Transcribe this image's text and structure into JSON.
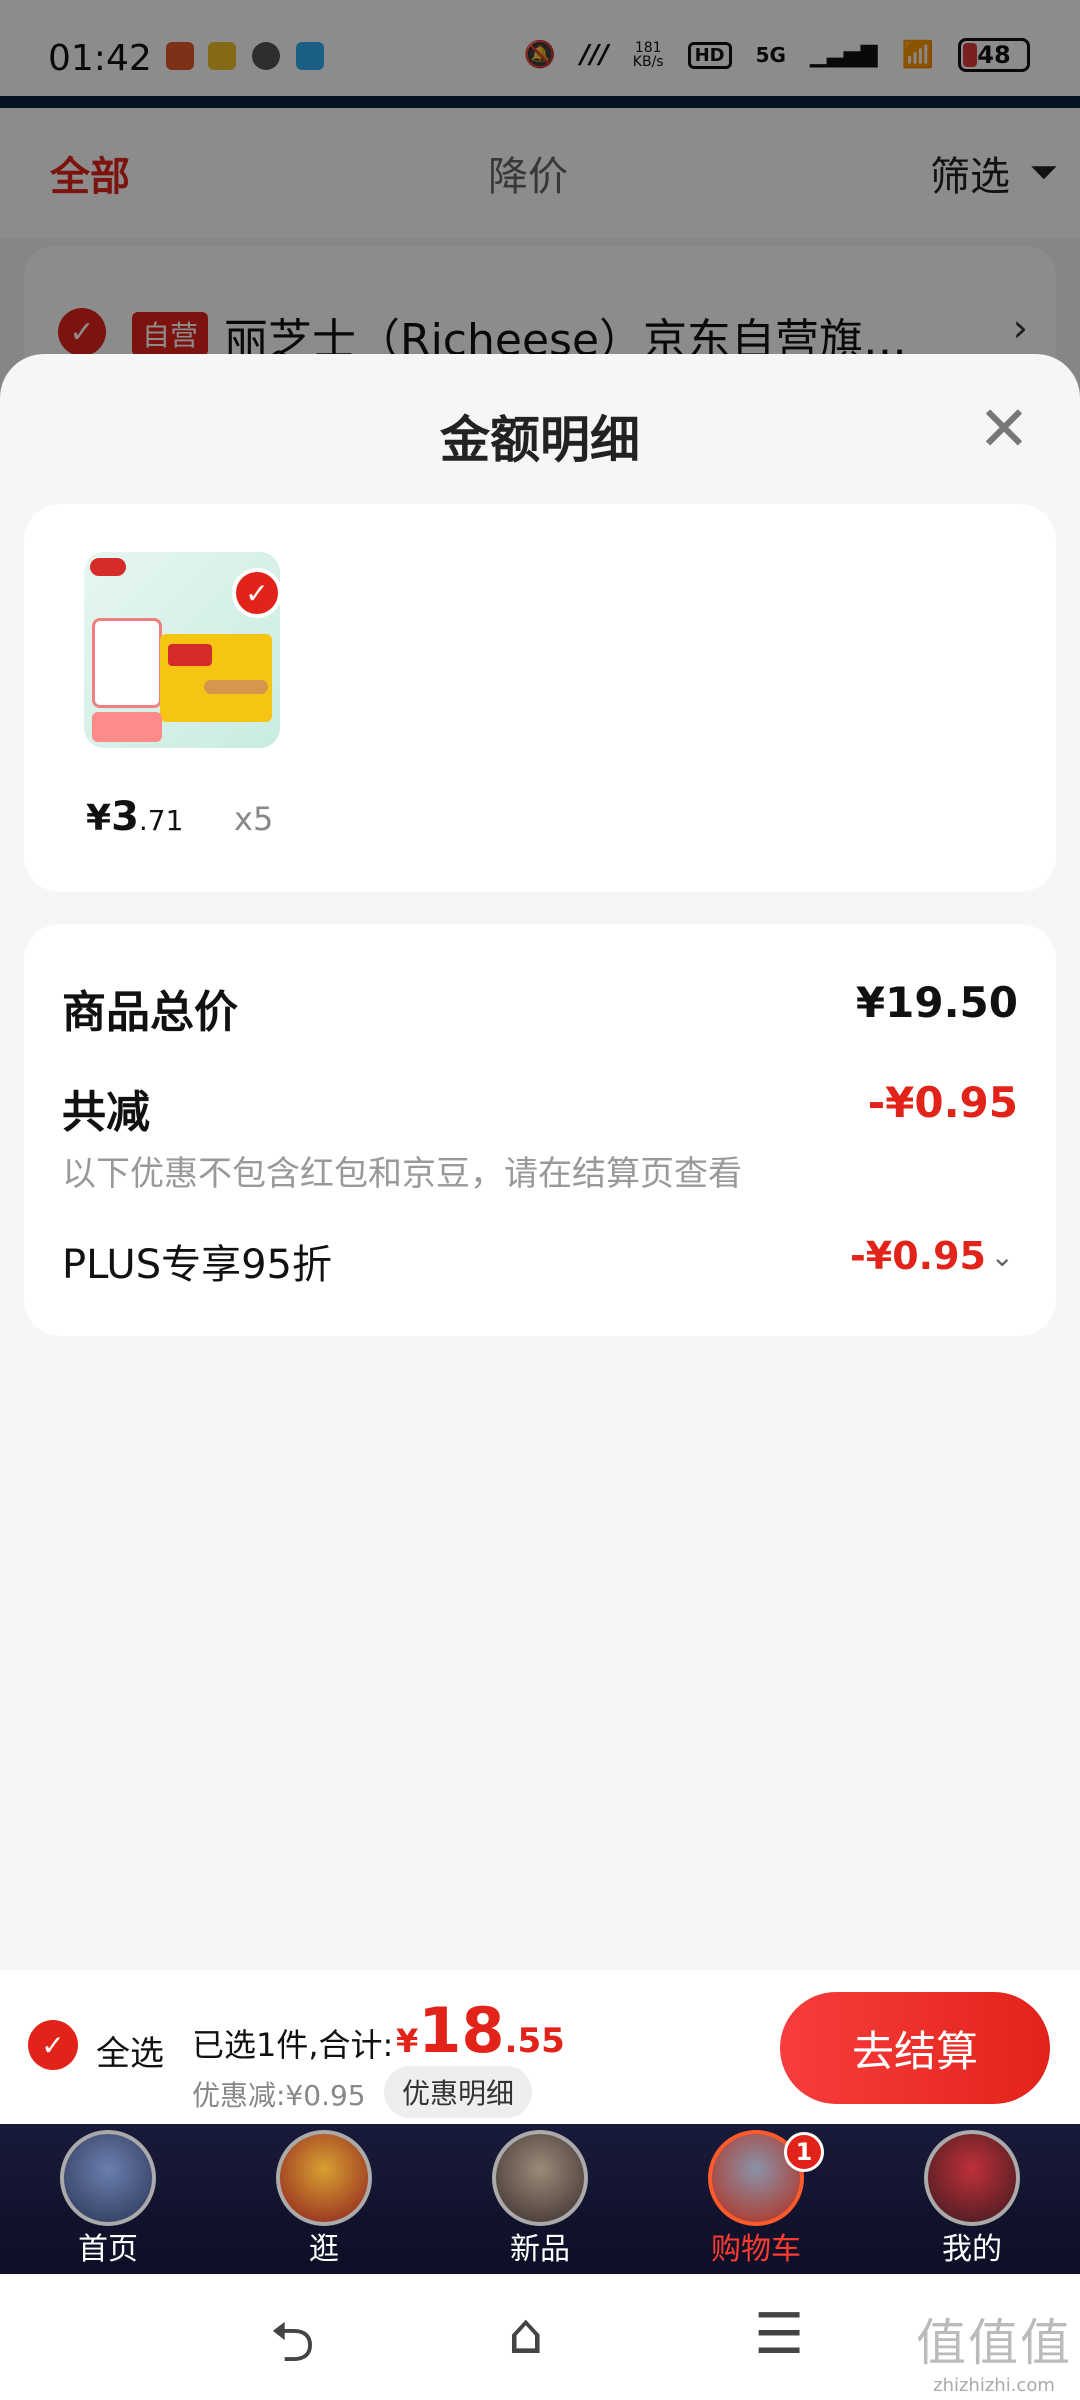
{
  "status_bar": {
    "time": "01:42",
    "speed_value": "181",
    "speed_unit": "KB/s",
    "hd": "HD",
    "network": "5G",
    "battery": "48"
  },
  "filter_bar": {
    "all": "全部",
    "price_drop": "降价",
    "filter": "筛选"
  },
  "shop": {
    "tag": "自营",
    "name": "丽芝士（Richeese）京东自营旗…"
  },
  "sheet": {
    "title": "金额明细",
    "goods": {
      "price_symbol": "¥",
      "price_int": "3",
      "price_dec": ".71",
      "qty": "x5"
    },
    "summary": {
      "total_label": "商品总价",
      "total_value": "¥19.50",
      "reduce_label": "共减",
      "reduce_value": "-¥0.95",
      "reduce_note": "以下优惠不包含红包和京豆，请在结算页查看",
      "plus_label": "PLUS专享95折",
      "plus_value": "-¥0.95"
    }
  },
  "checkout": {
    "select_all": "全选",
    "selected_text": "已选1件,合计:",
    "total_symbol": "¥",
    "total_int": "18",
    "total_dec": ".55",
    "discount_text": "优惠减:¥0.95",
    "detail_button": "优惠明细",
    "checkout_button": "去结算"
  },
  "tabs": [
    {
      "label": "首页"
    },
    {
      "label": "逛"
    },
    {
      "label": "新品"
    },
    {
      "label": "购物车",
      "badge": "1"
    },
    {
      "label": "我的"
    }
  ],
  "watermark": {
    "main": "值值值",
    "sub": "zhizhizhi.com"
  },
  "colors": {
    "accent": "#e2231a",
    "tabbar": "#181a3a"
  }
}
